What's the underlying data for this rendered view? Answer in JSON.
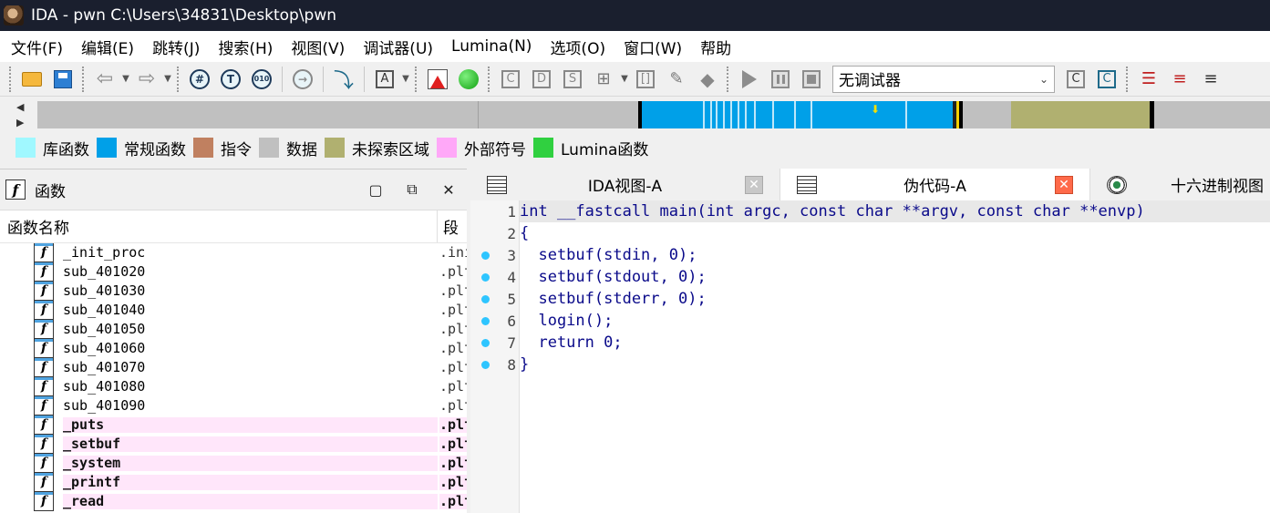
{
  "window": {
    "title": "IDA - pwn C:\\Users\\34831\\Desktop\\pwn"
  },
  "menu": [
    "文件(F)",
    "编辑(E)",
    "跳转(J)",
    "搜索(H)",
    "视图(V)",
    "调试器(U)",
    "Lumina(N)",
    "选项(O)",
    "窗口(W)",
    "帮助"
  ],
  "toolbar": {
    "debugger_selected": "无调试器",
    "icons": [
      "open-folder-icon",
      "save-icon",
      "back-arrow-icon",
      "forward-arrow-icon",
      "hash-icon",
      "text-icon",
      "binary-icon",
      "jump-icon",
      "step-into-icon",
      "string-icon",
      "red-triangle-icon",
      "green-ball-icon",
      "play-icon",
      "pause-icon",
      "stop-icon"
    ]
  },
  "legend": [
    {
      "label": "库函数",
      "color": "#a0f8ff"
    },
    {
      "label": "常规函数",
      "color": "#00a0e8"
    },
    {
      "label": "指令",
      "color": "#c08060"
    },
    {
      "label": "数据",
      "color": "#c0c0c0"
    },
    {
      "label": "未探索区域",
      "color": "#b0b070"
    },
    {
      "label": "外部符号",
      "color": "#ffa8f8"
    },
    {
      "label": "Lumina函数",
      "color": "#30d040"
    }
  ],
  "functions_panel": {
    "title": "函数",
    "columns": [
      "函数名称",
      "段"
    ],
    "rows": [
      {
        "name": "_init_proc",
        "segment": ".init",
        "external": false
      },
      {
        "name": "sub_401020",
        "segment": ".plt",
        "external": false
      },
      {
        "name": "sub_401030",
        "segment": ".plt",
        "external": false
      },
      {
        "name": "sub_401040",
        "segment": ".plt",
        "external": false
      },
      {
        "name": "sub_401050",
        "segment": ".plt",
        "external": false
      },
      {
        "name": "sub_401060",
        "segment": ".plt",
        "external": false
      },
      {
        "name": "sub_401070",
        "segment": ".plt",
        "external": false
      },
      {
        "name": "sub_401080",
        "segment": ".plt",
        "external": false
      },
      {
        "name": "sub_401090",
        "segment": ".plt",
        "external": false
      },
      {
        "name": "_puts",
        "segment": ".plt",
        "external": true
      },
      {
        "name": "_setbuf",
        "segment": ".plt",
        "external": true
      },
      {
        "name": "_system",
        "segment": ".plt",
        "external": true
      },
      {
        "name": "_printf",
        "segment": ".plt",
        "external": true
      },
      {
        "name": "_read",
        "segment": ".plt",
        "external": true
      }
    ]
  },
  "tabs": [
    {
      "label": "IDA视图-A",
      "active": false
    },
    {
      "label": "伪代码-A",
      "active": true
    },
    {
      "label": "十六进制视图",
      "active": false
    }
  ],
  "code": {
    "lines": [
      {
        "num": "1",
        "text": "int __fastcall main(int argc, const char **argv, const char **envp)",
        "dot": false
      },
      {
        "num": "2",
        "text": "{",
        "dot": false
      },
      {
        "num": "3",
        "text": "  setbuf(stdin, 0);",
        "dot": true
      },
      {
        "num": "4",
        "text": "  setbuf(stdout, 0);",
        "dot": true
      },
      {
        "num": "5",
        "text": "  setbuf(stderr, 0);",
        "dot": true
      },
      {
        "num": "6",
        "text": "  login();",
        "dot": true
      },
      {
        "num": "7",
        "text": "  return 0;",
        "dot": true
      },
      {
        "num": "8",
        "text": "}",
        "dot": true
      }
    ]
  }
}
